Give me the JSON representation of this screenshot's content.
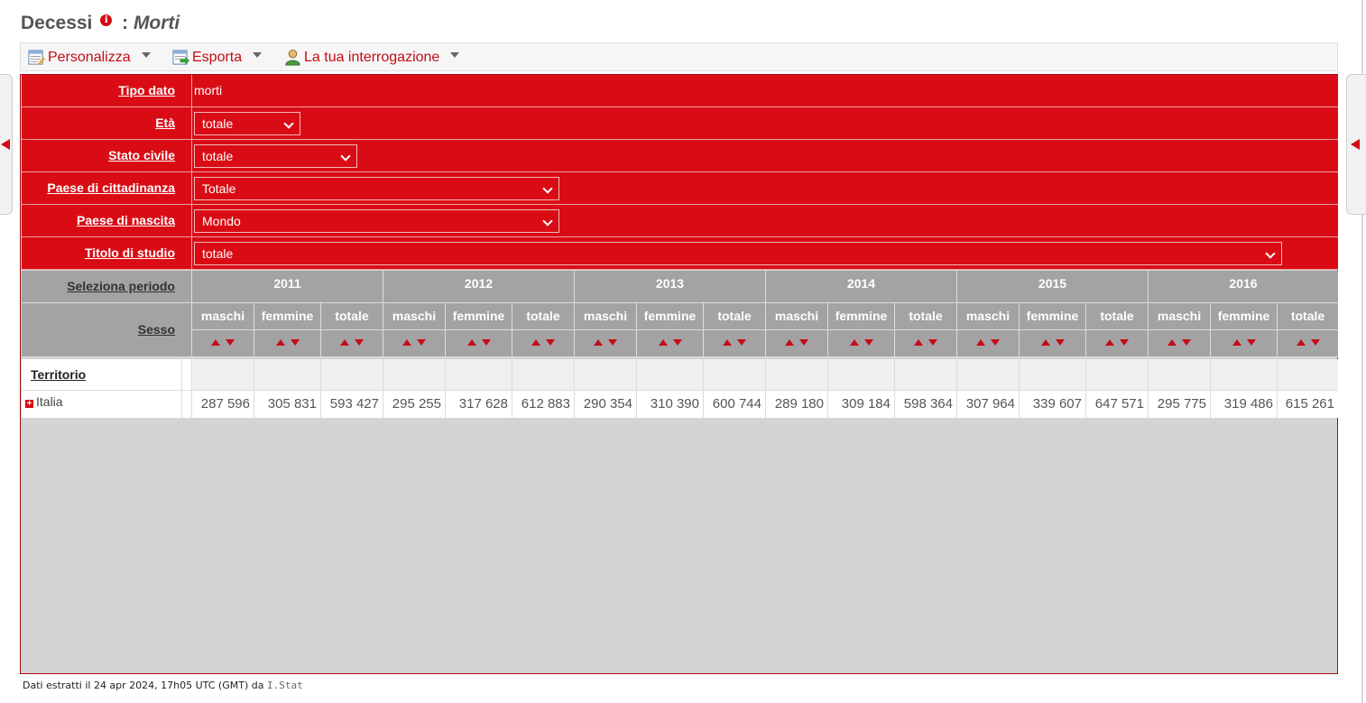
{
  "title": {
    "main": "Decessi",
    "separator": ":",
    "sub": "Morti",
    "info_icon": "info-icon"
  },
  "toolbar": {
    "items": [
      {
        "label": "Personalizza",
        "icon": "customize-icon"
      },
      {
        "label": "Esporta",
        "icon": "export-icon"
      },
      {
        "label": "La tua interrogazione",
        "icon": "user-icon"
      }
    ]
  },
  "filters": [
    {
      "label": "Tipo dato",
      "value": "morti"
    },
    {
      "label": "Età",
      "value": "totale"
    },
    {
      "label": "Stato civile",
      "value": "totale"
    },
    {
      "label": "Paese di cittadinanza",
      "value": "Totale"
    },
    {
      "label": "Paese di nascita",
      "value": "Mondo"
    },
    {
      "label": "Titolo di studio",
      "value": "totale"
    }
  ],
  "table": {
    "period_label": "Seleziona periodo",
    "sex_label": "Sesso",
    "territory_label": "Territorio",
    "years": [
      "2011",
      "2012",
      "2013",
      "2014",
      "2015",
      "2016"
    ],
    "sexes": [
      "maschi",
      "femmine",
      "totale"
    ],
    "rows": [
      {
        "label": "Italia",
        "values": [
          "287 596",
          "305 831",
          "593 427",
          "295 255",
          "317 628",
          "612 883",
          "290 354",
          "310 390",
          "600 744",
          "289 180",
          "309 184",
          "598 364",
          "307 964",
          "339 607",
          "647 571",
          "295 775",
          "319 486",
          "615 261"
        ]
      }
    ]
  },
  "footer": {
    "text": "Dati estratti il 24 apr 2024, 17h05 UTC (GMT) da",
    "link": "I.Stat"
  },
  "colors": {
    "accent": "#d90c15",
    "header_gray": "#a3a3a3",
    "panel_gray": "#d4d4d4"
  }
}
